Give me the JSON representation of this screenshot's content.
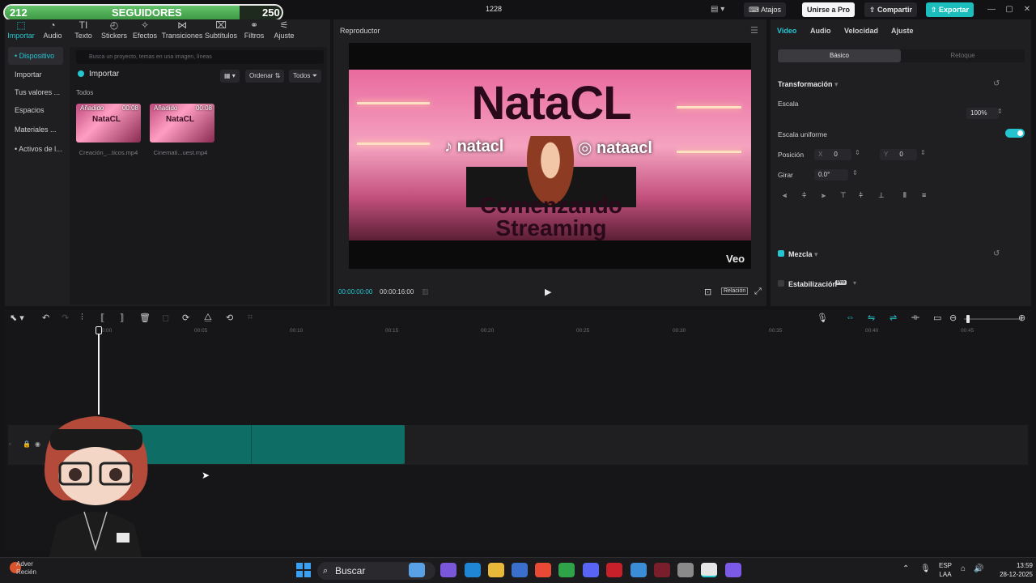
{
  "followers": {
    "current": "212",
    "label": "SEGUIDORES",
    "goal": "250"
  },
  "titlebar": {
    "project": "1228",
    "shortcuts": "Atajos",
    "pro": "Unirse a Pro",
    "share": "Compartir",
    "export": "Exportar"
  },
  "tools": [
    {
      "label": "Importar",
      "icon": "import-icon"
    },
    {
      "label": "Audio",
      "icon": "audio-icon"
    },
    {
      "label": "Texto",
      "icon": "text-icon"
    },
    {
      "label": "Stickers",
      "icon": "sticker-icon"
    },
    {
      "label": "Efectos",
      "icon": "effects-icon"
    },
    {
      "label": "Transiciones",
      "icon": "transitions-icon"
    },
    {
      "label": "Subtítulos",
      "icon": "subtitles-icon"
    },
    {
      "label": "Filtros",
      "icon": "filters-icon"
    },
    {
      "label": "Ajuste",
      "icon": "adjust-icon"
    }
  ],
  "sidebar": [
    {
      "label": "• Dispositivo"
    },
    {
      "label": "Importar"
    },
    {
      "label": "Tus valores ..."
    },
    {
      "label": "Espacios"
    },
    {
      "label": "Materiales ..."
    },
    {
      "label": "• Activos de l..."
    }
  ],
  "media": {
    "search_placeholder": "Busca un proyecto, temas en una imagen, líneas",
    "import": "Importar",
    "sort": "Ordenar",
    "filter": "Todos",
    "all": "Todos",
    "items": [
      {
        "badge": "Añadido",
        "duration": "00:08",
        "file": "Creación_...ticos.mp4",
        "thumb_text": "NataCL"
      },
      {
        "badge": "Añadido",
        "duration": "00:08",
        "file": "Cinemati...uest.mp4",
        "thumb_text": "NataCL"
      }
    ]
  },
  "player": {
    "title": "Reproductor",
    "brand": "NataCL",
    "tiktok": "natacl",
    "instagram": "nataacl",
    "line1": "Comenzando",
    "line2": "Streaming",
    "watermark": "Veo",
    "time_current": "00:00:00:00",
    "time_total": "00:00:16:00",
    "ratio": "Relación"
  },
  "inspector": {
    "tabs": [
      "Video",
      "Audio",
      "Velocidad",
      "Ajuste"
    ],
    "segment_a": "Básico",
    "segment_b": "Retoque",
    "transform": "Transformación",
    "scale_label": "Escala",
    "scale_value": "100%",
    "uniform_scale": "Escala uniforme",
    "position_label": "Posición",
    "pos_x_label": "X",
    "pos_x": "0",
    "pos_y_label": "Y",
    "pos_y": "0",
    "rotate_label": "Girar",
    "rotate_value": "0.0°",
    "blend": "Mezcla",
    "stabilization": "Estabilización",
    "pro_badge": "Pro"
  },
  "timeline": {
    "ticks": [
      "00:00",
      "00:05",
      "00:10",
      "00:15",
      "00:20",
      "00:25",
      "00:30",
      "00:35",
      "00:40",
      "00:45"
    ]
  },
  "taskbar": {
    "search": "Buscar",
    "lang_1": "ESP",
    "lang_2": "LAA",
    "time": "13:59",
    "date": "28-12-2025",
    "notif_1": "Adver",
    "notif_2": "Recién"
  },
  "colors": {
    "accent": "#25c5d0",
    "clip": "#0e6e66",
    "export": "#1bbdbd"
  }
}
